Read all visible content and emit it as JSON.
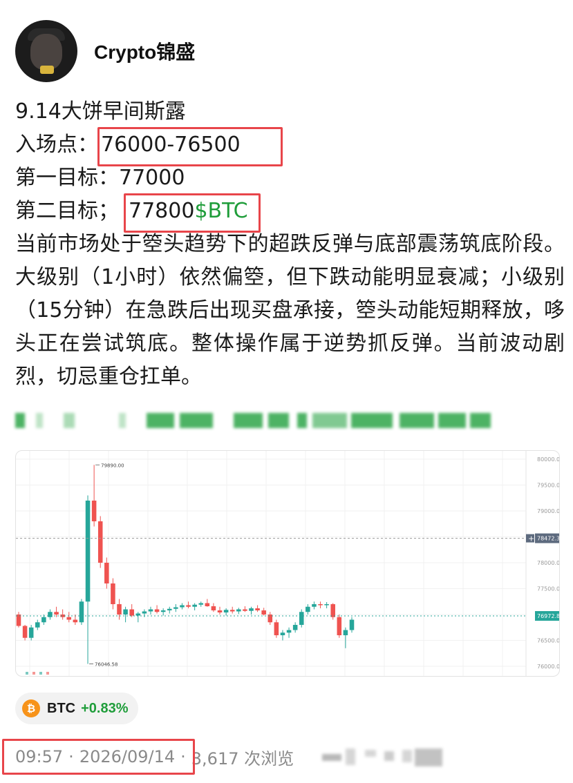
{
  "author": {
    "name": "Crypto锦盛"
  },
  "post": {
    "title": "9.14大饼早间斯露",
    "entry_label": "入场点：",
    "entry_value": "76000-76500",
    "target1_label": "第一目标：",
    "target1_value": "77000",
    "target2_label": "第二目标；",
    "target2_value": "77800",
    "target2_tag": "$BTC",
    "paragraph": "当前市场处于箜头趋势下的超跌反弹与底部震荡筑底阶段。大级别（1小时）依然偏箜，但下跌动能明显衰减；小级别（15分钟）在急跌后出现买盘承接，箜头动能短期释放，哆头正在尝试筑底。整体操作属于逆势抓反弹。当前波动剧烈，切忌重仓扛单。"
  },
  "colors": {
    "up": "#26a69a",
    "down": "#ef5350",
    "accent_green": "#1f9d3a",
    "highlight_box": "#e8454a"
  },
  "chart_data": {
    "type": "candlestick",
    "y_axis_ticks": [
      "80000.00",
      "79500.00",
      "79000.00",
      "78500.00",
      "78000.00",
      "77500.00",
      "77000.00",
      "76500.00",
      "76000.00"
    ],
    "ylim": [
      76000,
      80000
    ],
    "high_label": "79890.00",
    "high_value": 79890,
    "low_label": "76046.58",
    "low_value": 76046.58,
    "crosshair_label": "78472.36",
    "crosshair_value": 78472.36,
    "last_price_label": "76972.88",
    "last_price_value": 76972.88,
    "candles": [
      [
        77000,
        77050,
        76750,
        76780
      ],
      [
        76780,
        76800,
        76500,
        76550
      ],
      [
        76550,
        76800,
        76500,
        76750
      ],
      [
        76750,
        76900,
        76700,
        76850
      ],
      [
        76850,
        77000,
        76800,
        76950
      ],
      [
        76950,
        77100,
        76900,
        77050
      ],
      [
        77050,
        77150,
        76950,
        77000
      ],
      [
        77000,
        77100,
        76900,
        76950
      ],
      [
        76950,
        77050,
        76850,
        76900
      ],
      [
        76900,
        77000,
        76800,
        76850
      ],
      [
        76850,
        77300,
        76800,
        77250
      ],
      [
        77250,
        79300,
        77200,
        79200
      ],
      [
        79200,
        79890,
        78700,
        78800
      ],
      [
        78800,
        78900,
        77900,
        78000
      ],
      [
        78000,
        78100,
        77500,
        77600
      ],
      [
        77600,
        77700,
        77100,
        77200
      ],
      [
        77200,
        77300,
        76900,
        77000
      ],
      [
        77000,
        77150,
        76850,
        77100
      ],
      [
        77100,
        77200,
        76950,
        76980
      ],
      [
        76980,
        77050,
        76850,
        77020
      ],
      [
        77020,
        77100,
        76950,
        77060
      ],
      [
        77060,
        77150,
        77000,
        77100
      ],
      [
        77100,
        77180,
        77020,
        77050
      ],
      [
        77050,
        77120,
        76980,
        77080
      ],
      [
        77080,
        77150,
        77020,
        77110
      ],
      [
        77110,
        77200,
        77050,
        77140
      ],
      [
        77140,
        77220,
        77100,
        77180
      ],
      [
        77180,
        77250,
        77120,
        77150
      ],
      [
        77150,
        77220,
        77080,
        77190
      ],
      [
        77190,
        77250,
        77150,
        77220
      ],
      [
        77220,
        77300,
        77150,
        77160
      ],
      [
        77160,
        77220,
        77050,
        77080
      ],
      [
        77080,
        77150,
        77000,
        77040
      ],
      [
        77040,
        77120,
        76980,
        77090
      ],
      [
        77090,
        77150,
        77020,
        77060
      ],
      [
        77060,
        77130,
        77010,
        77100
      ],
      [
        77100,
        77160,
        77050,
        77070
      ],
      [
        77070,
        77150,
        77000,
        77120
      ],
      [
        77120,
        77180,
        77050,
        77080
      ],
      [
        77080,
        77130,
        76980,
        77000
      ],
      [
        77000,
        77050,
        76800,
        76850
      ],
      [
        76850,
        76900,
        76550,
        76600
      ],
      [
        76600,
        76700,
        76500,
        76650
      ],
      [
        76650,
        76750,
        76550,
        76700
      ],
      [
        76700,
        76850,
        76650,
        76800
      ],
      [
        76800,
        77100,
        76750,
        77050
      ],
      [
        77050,
        77200,
        77000,
        77150
      ],
      [
        77150,
        77250,
        77100,
        77200
      ],
      [
        77200,
        77250,
        77120,
        77180
      ],
      [
        77180,
        77240,
        77120,
        77200
      ],
      [
        77200,
        77220,
        76900,
        76950
      ],
      [
        76950,
        77000,
        76550,
        76600
      ],
      [
        76600,
        76750,
        76350,
        76700
      ],
      [
        76700,
        76950,
        76650,
        76900
      ]
    ]
  },
  "coin_chip": {
    "icon": "bitcoin-icon",
    "symbol": "BTC",
    "change": "+0.83%"
  },
  "meta": {
    "time": "09:57",
    "date": "2026/09/14",
    "views": "3,617 次浏览"
  }
}
